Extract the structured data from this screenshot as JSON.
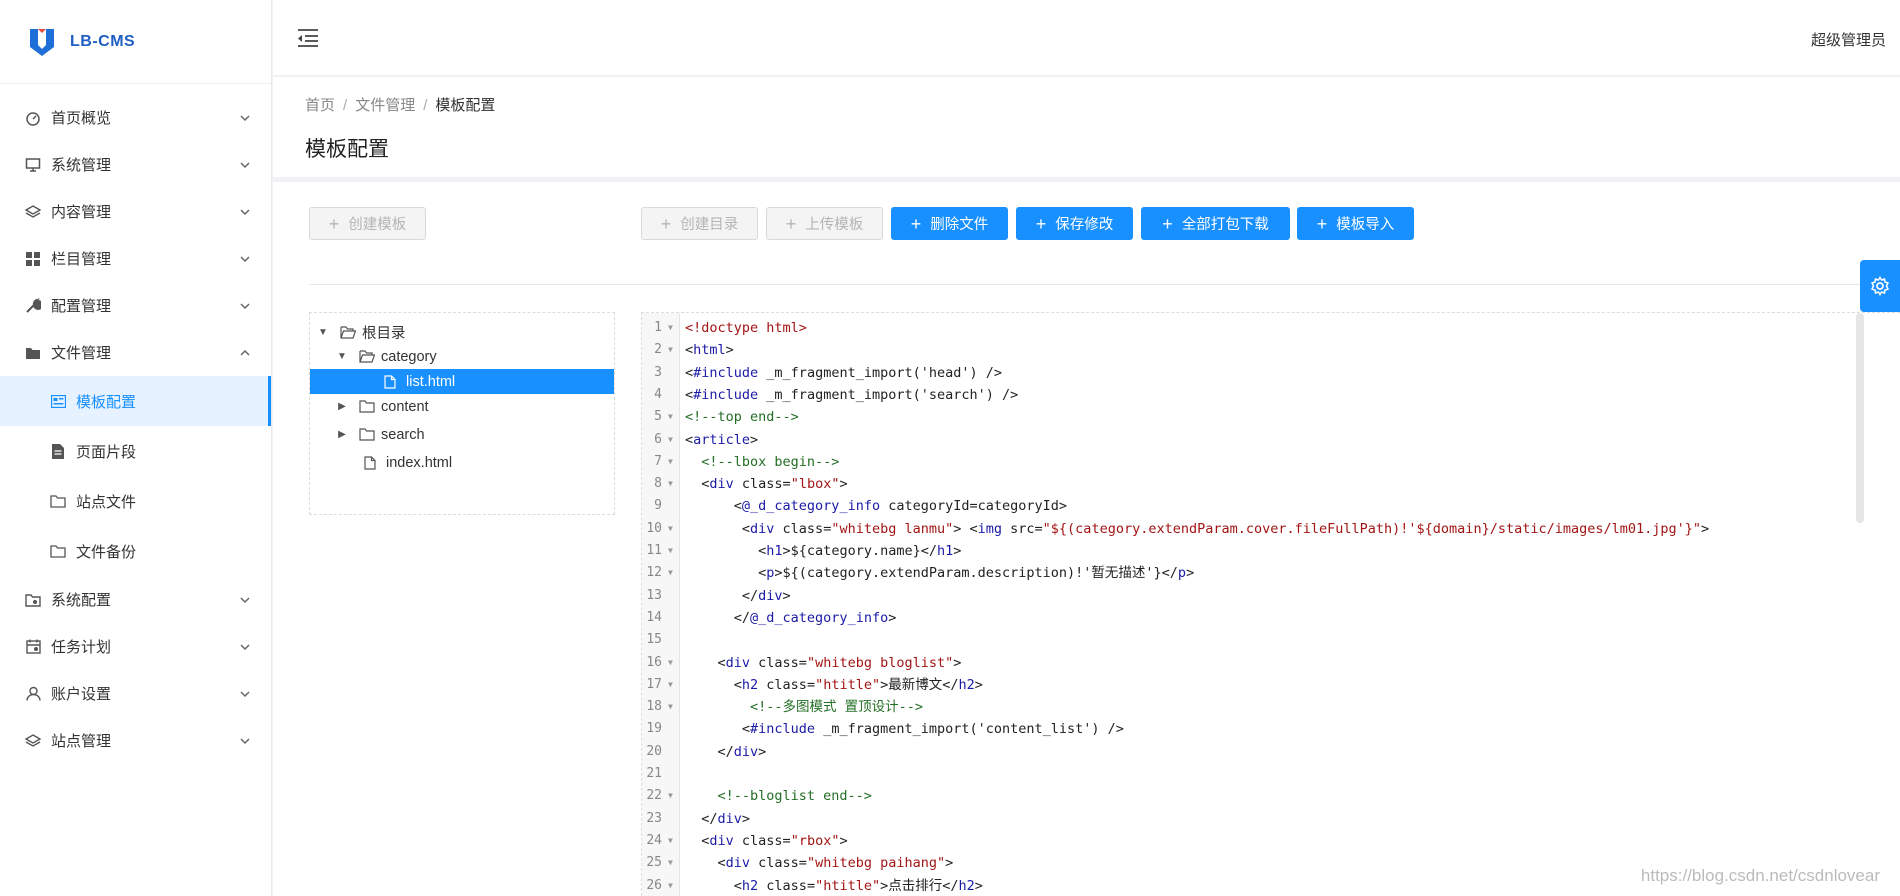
{
  "app": {
    "name": "LB-CMS",
    "user": "超级管理员",
    "brand_color": "#1890ff"
  },
  "sidebar": {
    "items": [
      {
        "label": "首页概览",
        "icon": "dashboard-icon"
      },
      {
        "label": "系统管理",
        "icon": "monitor-icon"
      },
      {
        "label": "内容管理",
        "icon": "layers-icon"
      },
      {
        "label": "栏目管理",
        "icon": "grid-icon"
      },
      {
        "label": "配置管理",
        "icon": "wrench-icon"
      },
      {
        "label": "文件管理",
        "icon": "folder-icon",
        "expanded": true
      },
      {
        "label": "系统配置",
        "icon": "folder-settings-icon"
      },
      {
        "label": "任务计划",
        "icon": "calendar-icon"
      },
      {
        "label": "账户设置",
        "icon": "user-icon"
      },
      {
        "label": "站点管理",
        "icon": "layers-icon"
      }
    ],
    "sub_items": [
      {
        "label": "模板配置",
        "icon": "template-icon",
        "active": true
      },
      {
        "label": "页面片段",
        "icon": "file-icon"
      },
      {
        "label": "站点文件",
        "icon": "folder-outline-icon"
      },
      {
        "label": "文件备份",
        "icon": "folder-outline-icon"
      }
    ]
  },
  "breadcrumb": [
    "首页",
    "文件管理",
    "模板配置"
  ],
  "page_title": "模板配置",
  "toolbar": {
    "create_template": "创建模板",
    "create_dir": "创建目录",
    "upload_template": "上传模板",
    "delete_file": "删除文件",
    "save_changes": "保存修改",
    "download_all": "全部打包下载",
    "import_template": "模板导入"
  },
  "tree": [
    {
      "label": "根目录",
      "level": 0,
      "type": "folder-open",
      "expanded": true
    },
    {
      "label": "category",
      "level": 1,
      "type": "folder-open",
      "expanded": true
    },
    {
      "label": "list.html",
      "level": 2,
      "type": "file",
      "selected": true
    },
    {
      "label": "content",
      "level": 1,
      "type": "folder",
      "expanded": false
    },
    {
      "label": "search",
      "level": 1,
      "type": "folder",
      "expanded": false
    },
    {
      "label": "index.html",
      "level": 1,
      "type": "file"
    }
  ],
  "code_lines": [
    {
      "n": "1",
      "fold": true,
      "text": "<!doctype html>"
    },
    {
      "n": "2",
      "fold": true,
      "text": "<html>"
    },
    {
      "n": "3",
      "fold": false,
      "text": "<#include _m_fragment_import('head') />"
    },
    {
      "n": "4",
      "fold": false,
      "text": "<#include _m_fragment_import('search') />"
    },
    {
      "n": "5",
      "fold": true,
      "text": "<!--top end-->"
    },
    {
      "n": "6",
      "fold": true,
      "text": "<article>"
    },
    {
      "n": "7",
      "fold": true,
      "text": "  <!--lbox begin-->"
    },
    {
      "n": "8",
      "fold": true,
      "text": "  <div class=\"lbox\">"
    },
    {
      "n": "9",
      "fold": false,
      "text": "      <@_d_category_info categoryId=categoryId>"
    },
    {
      "n": "10",
      "fold": true,
      "text": "       <div class=\"whitebg lanmu\"> <img src=\"${(category.extendParam.cover.fileFullPath)!'${domain}/static/images/lm01.jpg'}\">"
    },
    {
      "n": "11",
      "fold": true,
      "text": "         <h1>${category.name}</h1>"
    },
    {
      "n": "12",
      "fold": true,
      "text": "         <p>${(category.extendParam.description)!'暂无描述'}</p>"
    },
    {
      "n": "13",
      "fold": false,
      "text": "       </div>"
    },
    {
      "n": "14",
      "fold": false,
      "text": "      </@_d_category_info>"
    },
    {
      "n": "15",
      "fold": false,
      "text": ""
    },
    {
      "n": "16",
      "fold": true,
      "text": "    <div class=\"whitebg bloglist\">"
    },
    {
      "n": "17",
      "fold": true,
      "text": "      <h2 class=\"htitle\">最新博文</h2>"
    },
    {
      "n": "18",
      "fold": true,
      "text": "        <!--多图模式 置顶设计-->"
    },
    {
      "n": "19",
      "fold": false,
      "text": "       <#include _m_fragment_import('content_list') />"
    },
    {
      "n": "20",
      "fold": false,
      "text": "    </div>"
    },
    {
      "n": "21",
      "fold": false,
      "text": ""
    },
    {
      "n": "22",
      "fold": true,
      "text": "    <!--bloglist end-->"
    },
    {
      "n": "23",
      "fold": false,
      "text": "  </div>"
    },
    {
      "n": "24",
      "fold": true,
      "text": "  <div class=\"rbox\">"
    },
    {
      "n": "25",
      "fold": true,
      "text": "    <div class=\"whitebg paihang\">"
    },
    {
      "n": "26",
      "fold": true,
      "text": "      <h2 class=\"htitle\">点击排行</h2>"
    }
  ],
  "watermark": "https://blog.csdn.net/csdnlovear"
}
